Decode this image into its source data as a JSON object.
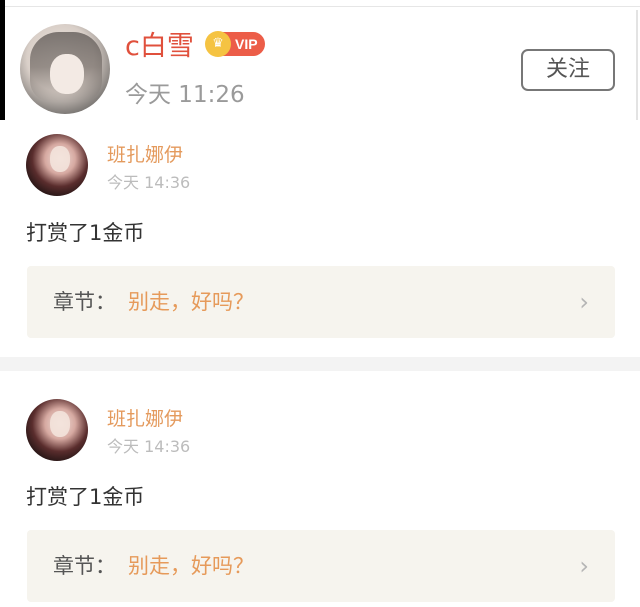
{
  "header": {
    "name": "c白雪",
    "vip_label": "VIP",
    "crown_icon": "♛",
    "time": "今天 11:26",
    "follow_label": "关注"
  },
  "items": [
    {
      "name": "班扎娜伊",
      "time": "今天 14:36",
      "message": "打赏了1金币",
      "chapter_label": "章节：",
      "chapter_title": "别走，好吗？"
    },
    {
      "name": "班扎娜伊",
      "time": "今天 14:36",
      "message": "打赏了1金币",
      "chapter_label": "章节：",
      "chapter_title": "别走，好吗？"
    }
  ],
  "icons": {
    "chevron": "chevron-right-icon"
  },
  "colors": {
    "name": "#e0503c",
    "vip": "#ec5d48",
    "crown": "#f5c342",
    "user_name": "#e49a5d",
    "chapter_bg": "#f6f4ee"
  }
}
